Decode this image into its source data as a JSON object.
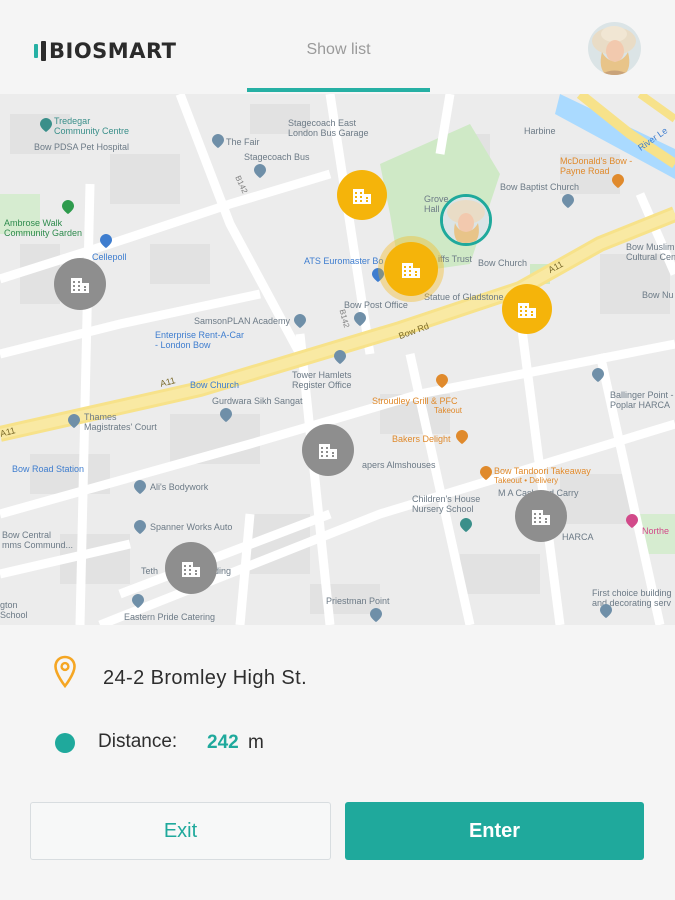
{
  "app": {
    "logo_text": "BIOSMART"
  },
  "header": {
    "tab_label": "Show list"
  },
  "colors": {
    "accent": "#1fa99c",
    "marker_active": "#f5b40a",
    "marker_inactive": "#8e8e8e",
    "pin": "#f5a623"
  },
  "map": {
    "labels": {
      "tredegar": "Tredegar\nCommunity Centre",
      "pdsa": "Bow PDSA Pet Hospital",
      "the_fair": "The Fair",
      "stagecoach_east": "Stagecoach East\nLondon Bus Garage",
      "stagecoach_bus": "Stagecoach Bus",
      "ambrose": "Ambrose Walk\nCommunity Garden",
      "cellepoll": "Cellepoll",
      "ats": "ATS Euromaster Bo",
      "bow_post_office": "Bow Post Office",
      "samsonplan": "SamsonPLAN Academy",
      "enterprise": "Enterprise Rent-A-Car\n- London Bow",
      "bow_church_station": "Bow Church",
      "tower_hamlets": "Tower Hamlets\nRegister Office",
      "gurdwara": "Gurdwara Sikh Sangat",
      "thames_court": "Thames\nMagistrates' Court",
      "bow_road_station": "Bow Road Station",
      "alis": "Ali's Bodywork",
      "spanner": "Spanner Works Auto",
      "bow_central": "Bow Central\nmms Commund...",
      "teth": "Teth",
      "ding": "ding",
      "eastern_pride": "Eastern Pride Catering",
      "gton_school": "gton\nSchool",
      "priestman": "Priestman Point",
      "childrens_house": "Children's House\nNursery School",
      "bakers": "Bakers Delight",
      "strodley": "Stroudley Grill & PFC",
      "strodley_sub": "Takeout",
      "bow_tandoori": "Bow Tandoori Takeaway",
      "bow_tandoori_sub": "Takeout • Delivery",
      "ma_cash": "M A Cash and Carry",
      "harca": "HARCA",
      "ballinger": "Ballinger Point -\nPoplar HARCA",
      "first_choice": "First choice building\nand decorating serv",
      "northe": "Northe",
      "statue": "Statue of Gladstone",
      "bow_church": "Bow Church",
      "bow_baptist": "Bow Baptist Church",
      "mcdonalds": "McDonald's Bow -\nPayne Road",
      "harbine": "Harbine",
      "bow_muslim": "Bow Muslim\nCultural Cen",
      "bow_nu": "Bow Nu",
      "groves_hall": "Grove\nHall",
      "iffs_trust": "iffs Trust",
      "river_lea": "River Le",
      "apers_almshouses": "apers Almshouses",
      "a11_left": "A11",
      "a11_mid": "A11",
      "a11_right": "A11",
      "bow_rd": "Bow Rd",
      "b142_a": "B142",
      "b142_b": "B142"
    }
  },
  "location": {
    "address": "24-2 Bromley High St.",
    "distance_label": "Distance:",
    "distance_value": "242",
    "distance_unit": "m"
  },
  "actions": {
    "exit_label": "Exit",
    "enter_label": "Enter"
  }
}
